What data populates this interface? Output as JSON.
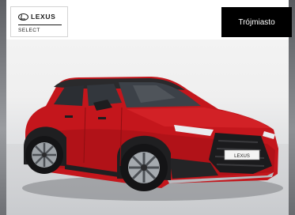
{
  "brand": {
    "logo_text": "LEXUS",
    "subtitle": "SELECT"
  },
  "location_badge": {
    "label": "Trójmiasto"
  },
  "vehicle_image": {
    "paint_color": "#c4161c",
    "plate_text": "LEXUS"
  },
  "colors": {
    "badge_background": "#000000",
    "badge_text": "#ffffff",
    "logo_text": "#1a1a1a"
  }
}
